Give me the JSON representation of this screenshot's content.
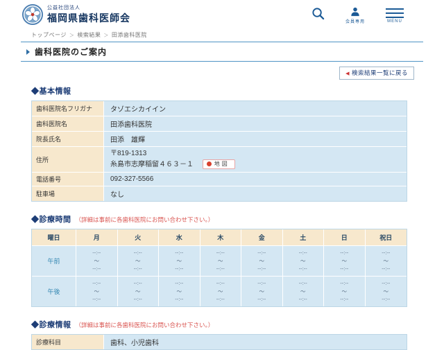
{
  "colors": {
    "navy_heading": "#1d3d76",
    "note_red": "#d9534f",
    "label_beige": "#f7e8cd",
    "value_blue": "#d4e7f3",
    "icon_blue": "#1b5a96",
    "rule_blue": "#4e93c4",
    "map_dot_red": "#d8402e"
  },
  "header": {
    "org_type": "公益社団法人",
    "org_name": "福岡県歯科医師会",
    "members_label": "会員専用",
    "menu_label": "MENU"
  },
  "breadcrumb": {
    "items": [
      "トップページ",
      "検索結果",
      "田添歯科医院"
    ],
    "separator": "＞"
  },
  "page": {
    "title": "歯科医院のご案内",
    "back_button": "検索結果一覧に戻る",
    "back_arrow": "◀"
  },
  "basic_info": {
    "heading": "◆基本情報",
    "rows": [
      {
        "label": "歯科医院名フリガナ",
        "value": "タゾエシカイイン"
      },
      {
        "label": "歯科医院名",
        "value": "田添歯科医院"
      },
      {
        "label": "院長氏名",
        "value": "田添　雄輝"
      },
      {
        "label": "住所",
        "value_line1": "〒819-1313",
        "value_line2": "糸島市志摩稲留４６３－１",
        "map_button": "地図"
      },
      {
        "label": "電話番号",
        "value": "092-327-5566"
      },
      {
        "label": "駐車場",
        "value": "なし"
      }
    ]
  },
  "hours": {
    "heading": "◆診療時間",
    "note": "（詳細は事前に各歯科医院にお問い合わせ下さい。）",
    "table": {
      "corner": "曜日",
      "days": [
        "月",
        "火",
        "水",
        "木",
        "金",
        "土",
        "日",
        "祝日"
      ],
      "rows": [
        {
          "label": "午前",
          "cells": [
            [
              "--:--",
              "～",
              "--:--"
            ],
            [
              "--:--",
              "～",
              "--:--"
            ],
            [
              "--:--",
              "～",
              "--:--"
            ],
            [
              "--:--",
              "～",
              "--:--"
            ],
            [
              "--:--",
              "～",
              "--:--"
            ],
            [
              "--:--",
              "～",
              "--:--"
            ],
            [
              "--:--",
              "～",
              "--:--"
            ],
            [
              "--:--",
              "～",
              "--:--"
            ]
          ]
        },
        {
          "label": "午後",
          "cells": [
            [
              "--:--",
              "～",
              "--:--"
            ],
            [
              "--:--",
              "～",
              "--:--"
            ],
            [
              "--:--",
              "～",
              "--:--"
            ],
            [
              "--:--",
              "～",
              "--:--"
            ],
            [
              "--:--",
              "～",
              "--:--"
            ],
            [
              "--:--",
              "～",
              "--:--"
            ],
            [
              "--:--",
              "～",
              "--:--"
            ],
            [
              "--:--",
              "～",
              "--:--"
            ]
          ]
        }
      ]
    }
  },
  "treatment": {
    "heading": "◆診療情報",
    "note": "（詳細は事前に各歯科医院にお問い合わせ下さい。）",
    "rows": [
      {
        "label": "診療科目",
        "value": "歯科、小児歯科"
      }
    ]
  }
}
